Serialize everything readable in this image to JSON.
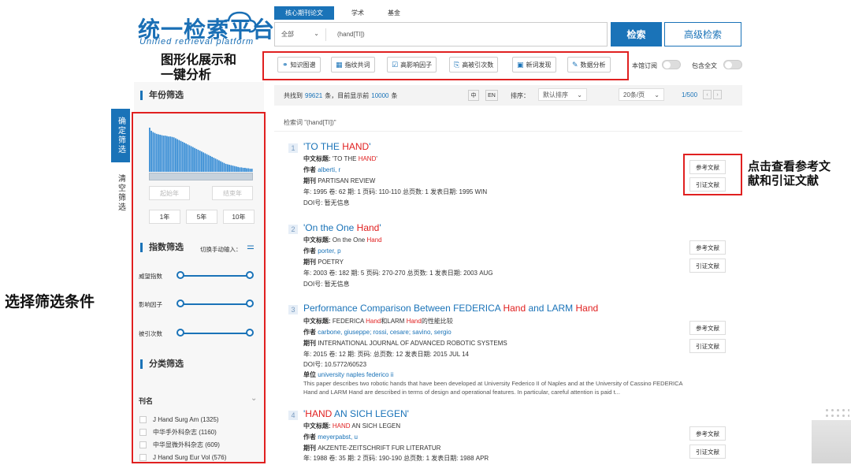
{
  "logo": {
    "title": "统一检索平台",
    "subtitle": "Unified  retrieval  platform"
  },
  "annotations": {
    "viz": [
      "图形化展示和",
      "一键分析"
    ],
    "refs": [
      "点击查看参考文",
      "献和引证文献"
    ],
    "filter": "选择筛选条件"
  },
  "tabs": [
    "核心期刊论文",
    "学术",
    "基金"
  ],
  "search": {
    "scope": "全部",
    "query": "(hand[TI])",
    "search_label": "检索",
    "advanced_label": "高级检索"
  },
  "tools": [
    "知识图谱",
    "指纹共词",
    "高影响因子",
    "高被引次数",
    "新词发现",
    "数据分析"
  ],
  "toggles": [
    "本馆订阅",
    "包含全文"
  ],
  "side_tabs": [
    "确定筛选",
    "清空筛选"
  ],
  "year_filter": {
    "title": "年份筛选",
    "start_placeholder": "起始年",
    "end_placeholder": "结束年",
    "buttons": [
      "1年",
      "5年",
      "10年"
    ],
    "histogram": [
      1.0,
      0.93,
      0.9,
      0.88,
      0.86,
      0.85,
      0.84,
      0.83,
      0.82,
      0.82,
      0.81,
      0.8,
      0.8,
      0.79,
      0.78,
      0.76,
      0.74,
      0.72,
      0.7,
      0.68,
      0.66,
      0.64,
      0.62,
      0.6,
      0.58,
      0.56,
      0.54,
      0.52,
      0.5,
      0.48,
      0.46,
      0.44,
      0.42,
      0.4,
      0.38,
      0.36,
      0.34,
      0.32,
      0.3,
      0.28,
      0.26,
      0.24,
      0.22,
      0.2,
      0.18,
      0.17,
      0.16,
      0.15,
      0.14,
      0.13,
      0.12,
      0.11,
      0.1,
      0.1,
      0.09,
      0.09,
      0.08,
      0.08,
      0.07,
      0.07
    ]
  },
  "index_filter": {
    "title": "指数筛选",
    "manual": "切换手动输入：",
    "sliders": [
      "威望指数",
      "影响因子",
      "被引次数"
    ]
  },
  "category_filter": {
    "title": "分类筛选",
    "group": "刊名",
    "items": [
      "J Hand Surg Am (1325)",
      "中华手外科杂志 (1160)",
      "中华显微外科杂志 (609)",
      "J Hand Surg Eur Vol (576)"
    ]
  },
  "results_bar": {
    "found_prefix": "共找到",
    "total": "99621",
    "mid": "条，目前显示前",
    "shown": "10000",
    "suffix": "条",
    "lang_zh": "中",
    "lang_en": "EN",
    "sort_label": "排序：",
    "sort_value": "默认排序",
    "per_page": "20条/页",
    "page": "1/500"
  },
  "query_label": "检索词 \"(hand[TI])\"",
  "buttons": {
    "refs": "参考文献",
    "cites": "引证文献"
  },
  "results": [
    {
      "num": "1",
      "title_pre": "'TO THE ",
      "title_hit": "HAND",
      "title_post": "'",
      "cn_label": "中文标题:",
      "cn_pre": " 'TO THE ",
      "cn_hit": "HAND",
      "cn_post": "'",
      "author_label": "作者",
      "authors": "alberti, r",
      "journal_label": "期刊",
      "journal": "PARTISAN REVIEW",
      "meta": "年: 1995   卷: 62   期: 1   页码: 110-110   总页数: 1   发表日期: 1995 WIN",
      "doi": "DOI号:  暂无信息"
    },
    {
      "num": "2",
      "title_pre": "'On the One ",
      "title_hit": "Hand",
      "title_post": "'",
      "cn_label": "中文标题:",
      "cn_pre": " On the One ",
      "cn_hit": "Hand",
      "cn_post": "",
      "author_label": "作者",
      "authors": "porter, p",
      "journal_label": "期刊",
      "journal": "POETRY",
      "meta": "年: 2003   卷: 182   期: 5   页码: 270-270   总页数: 1   发表日期: 2003 AUG",
      "doi": "DOI号:  暂无信息"
    },
    {
      "num": "3",
      "title_pre": "Performance Comparison Between FEDERICA ",
      "title_hit": "Hand",
      "title_mid": " and LARM ",
      "title_hit2": "Hand",
      "title_post": "",
      "cn_label": "中文标题:",
      "cn_pre": " FEDERICA ",
      "cn_hit": "Hand",
      "cn_mid": "和LARM ",
      "cn_hit2": "Hand",
      "cn_post": "的性能比较",
      "author_label": "作者",
      "authors": "carbone, giuseppe;   rossi, cesare;   savino, sergio",
      "journal_label": "期刊",
      "journal": "INTERNATIONAL JOURNAL OF ADVANCED ROBOTIC SYSTEMS",
      "meta": "年: 2015   卷: 12   期:     页码:     总页数: 12   发表日期: 2015 JUL 14",
      "doi": "DOI号:  10.5772/60523",
      "unit_label": "单位",
      "unit": "university naples federico ii",
      "abstract": "This paper describes two robotic hands that have been developed at University Federico II of Naples and at the University of Cassino FEDERICA Hand and LARM Hand are described in terms of design and operational features. In particular, careful attention is paid t..."
    },
    {
      "num": "4",
      "title_pre": "'",
      "title_hit": "HAND",
      "title_post": " AN SICH LEGEN'",
      "cn_label": "中文标题:",
      "cn_pre": " ",
      "cn_hit": "HAND",
      "cn_post": " AN SICH LEGEN",
      "author_label": "作者",
      "authors": "meyerpabst, u",
      "journal_label": "期刊",
      "journal": "AKZENTE-ZEITSCHRIFT FUR LITERATUR",
      "meta": "年: 1988   卷: 35   期: 2   页码: 190-190   总页数: 1   发表日期: 1988 APR"
    }
  ]
}
